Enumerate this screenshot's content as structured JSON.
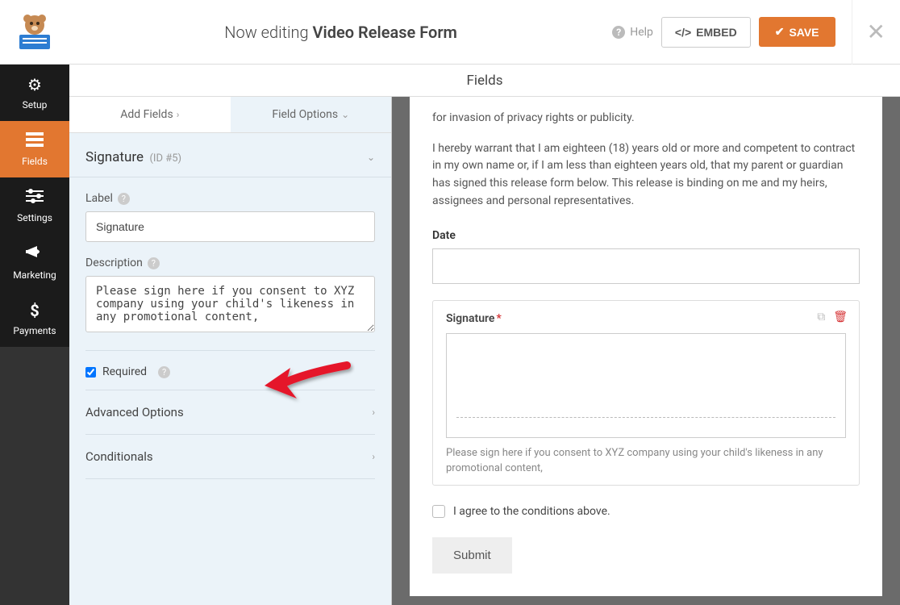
{
  "header": {
    "editing_prefix": "Now editing ",
    "form_name": "Video Release Form",
    "help_label": "Help",
    "embed_label": "EMBED",
    "save_label": "SAVE"
  },
  "sidebar": {
    "setup": "Setup",
    "fields": "Fields",
    "settings": "Settings",
    "marketing": "Marketing",
    "payments": "Payments"
  },
  "panel_title": "Fields",
  "tabs": {
    "add": "Add Fields",
    "options": "Field Options"
  },
  "field": {
    "name": "Signature",
    "id": "(ID #5)",
    "label_label": "Label",
    "label_value": "Signature",
    "desc_label": "Description",
    "desc_value": "Please sign here if you consent to XYZ company using your child's likeness in any promotional content,",
    "required_label": "Required",
    "required_checked": true,
    "advanced": "Advanced Options",
    "conditionals": "Conditionals"
  },
  "preview": {
    "para1_tail": "for invasion of privacy rights or publicity.",
    "para2": "I hereby warrant that I am eighteen (18) years old or more and competent to contract in my own name or, if I am less than eighteen years old, that my parent or guardian has signed this release form below. This release is binding on me and my heirs, assignees and personal representatives.",
    "date_label": "Date",
    "sig_label": "Signature",
    "sig_desc": "Please sign here if you consent to XYZ company using your child's likeness in any promotional content,",
    "agree_label": "I agree to the conditions above.",
    "submit_label": "Submit"
  }
}
